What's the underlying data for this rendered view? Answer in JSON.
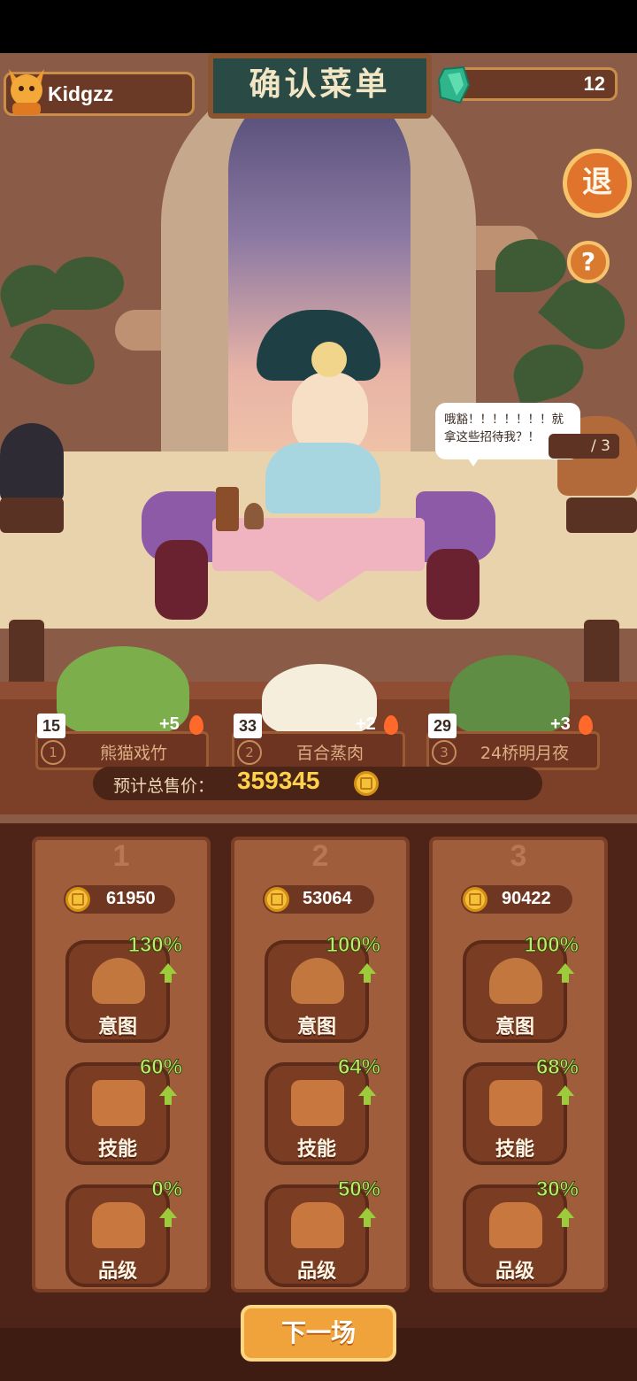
{
  "header": {
    "username": "Kidgzz",
    "title": "确认菜单",
    "gem_count": "12",
    "exit_label": "退",
    "help_label": "?"
  },
  "scene": {
    "speech": "哦豁！！！！！！！就拿这些招待我？！",
    "progress": "/ 3"
  },
  "dishes": [
    {
      "qty": "15",
      "rank": "1",
      "name": "熊猫戏竹",
      "bonus": "+5"
    },
    {
      "qty": "33",
      "rank": "2",
      "name": "百合蒸肉",
      "bonus": "+2"
    },
    {
      "qty": "29",
      "rank": "3",
      "name": "24桥明月夜",
      "bonus": "+3"
    }
  ],
  "total": {
    "label": "预计总售价：",
    "value": "359345"
  },
  "columns": [
    {
      "num": "1",
      "price": "61950",
      "stats": [
        {
          "pct": "130%",
          "label": "意图"
        },
        {
          "pct": "60%",
          "label": "技能"
        },
        {
          "pct": "0%",
          "label": "品级"
        }
      ]
    },
    {
      "num": "2",
      "price": "53064",
      "stats": [
        {
          "pct": "100%",
          "label": "意图"
        },
        {
          "pct": "64%",
          "label": "技能"
        },
        {
          "pct": "50%",
          "label": "品级"
        }
      ]
    },
    {
      "num": "3",
      "price": "90422",
      "stats": [
        {
          "pct": "100%",
          "label": "意图"
        },
        {
          "pct": "68%",
          "label": "技能"
        },
        {
          "pct": "30%",
          "label": "品级"
        }
      ]
    }
  ],
  "next_button": "下一场",
  "colors": {
    "accent": "#f0a33a",
    "gold": "#ffd24a",
    "up": "#9ccc3b"
  }
}
